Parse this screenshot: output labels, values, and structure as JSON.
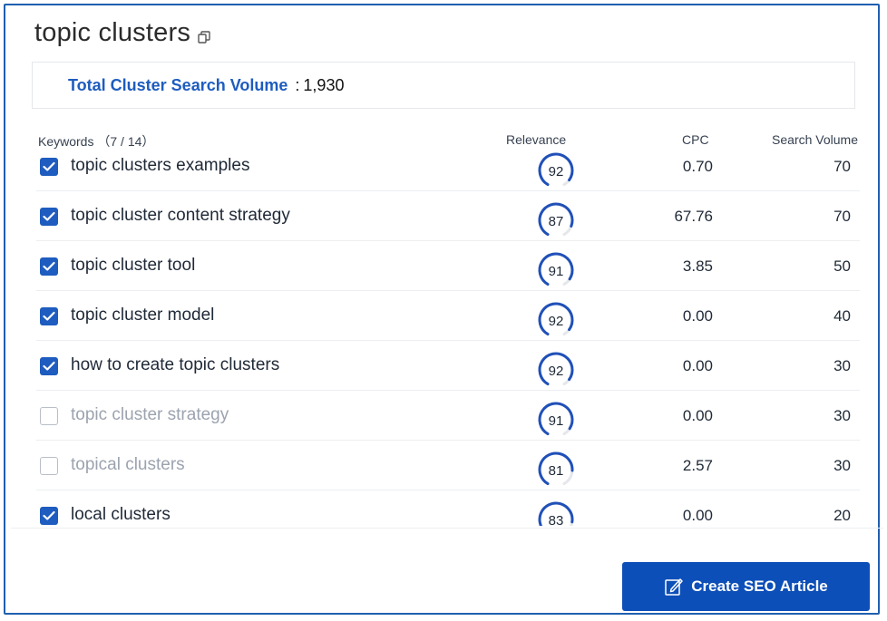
{
  "header": {
    "title": "topic clusters",
    "copy_icon": "copy-icon"
  },
  "summary": {
    "label": "Total Cluster Search Volume",
    "separator": ":",
    "value": "1,930"
  },
  "table": {
    "headers": {
      "keywords": "Keywords （7 / 14）",
      "relevance": "Relevance",
      "cpc": "CPC",
      "search_volume": "Search Volume"
    },
    "rows": [
      {
        "keyword": "topic clusters examples",
        "checked": true,
        "relevance": 92,
        "cpc": "0.70",
        "search_volume": "70"
      },
      {
        "keyword": "topic cluster content strategy",
        "checked": true,
        "relevance": 87,
        "cpc": "67.76",
        "search_volume": "70"
      },
      {
        "keyword": "topic cluster tool",
        "checked": true,
        "relevance": 91,
        "cpc": "3.85",
        "search_volume": "50"
      },
      {
        "keyword": "topic cluster model",
        "checked": true,
        "relevance": 92,
        "cpc": "0.00",
        "search_volume": "40"
      },
      {
        "keyword": "how to create topic clusters",
        "checked": true,
        "relevance": 92,
        "cpc": "0.00",
        "search_volume": "30"
      },
      {
        "keyword": "topic cluster strategy",
        "checked": false,
        "relevance": 91,
        "cpc": "0.00",
        "search_volume": "30"
      },
      {
        "keyword": "topical clusters",
        "checked": false,
        "relevance": 81,
        "cpc": "2.57",
        "search_volume": "30"
      },
      {
        "keyword": "local clusters",
        "checked": true,
        "relevance": 83,
        "cpc": "0.00",
        "search_volume": "20"
      }
    ]
  },
  "cta": {
    "label": "Create SEO Article",
    "icon": "edit-icon"
  },
  "colors": {
    "accent": "#1e5cbf",
    "button": "#0d4fb8",
    "gauge_fill": "#2050b8",
    "gauge_track": "#e5e7eb",
    "unchecked_text": "#9ca3af"
  }
}
